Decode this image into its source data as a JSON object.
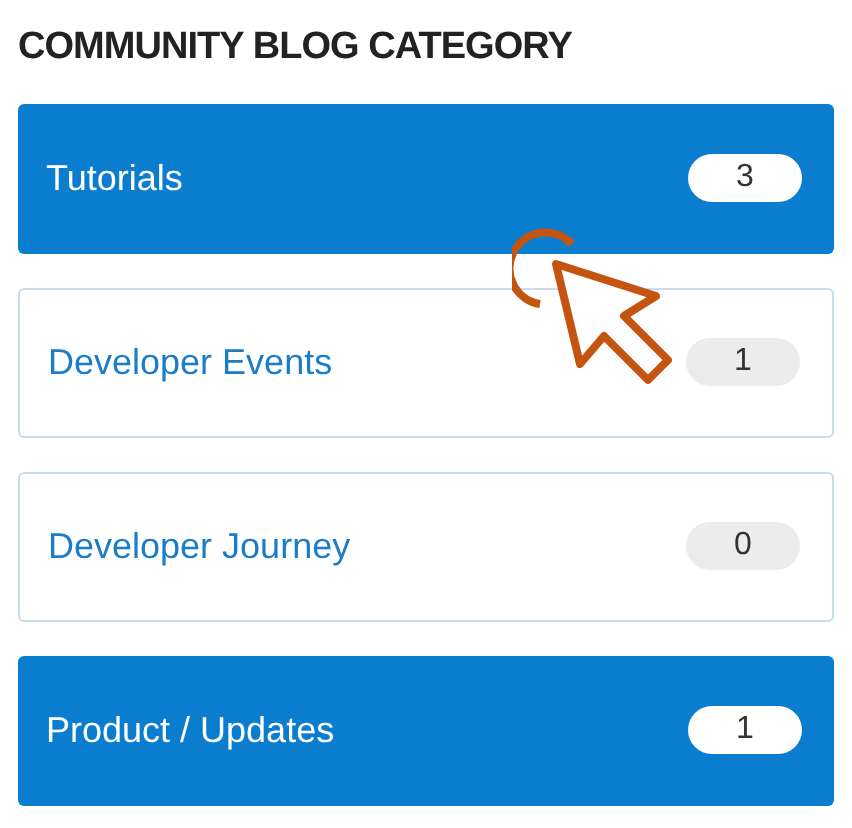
{
  "heading": "COMMUNITY BLOG CATEGORY",
  "categories": [
    {
      "label": "Tutorials",
      "count": "3",
      "selected": true
    },
    {
      "label": "Developer Events",
      "count": "1",
      "selected": false
    },
    {
      "label": "Developer Journey",
      "count": "0",
      "selected": false
    },
    {
      "label": "Product / Updates",
      "count": "1",
      "selected": true
    }
  ]
}
